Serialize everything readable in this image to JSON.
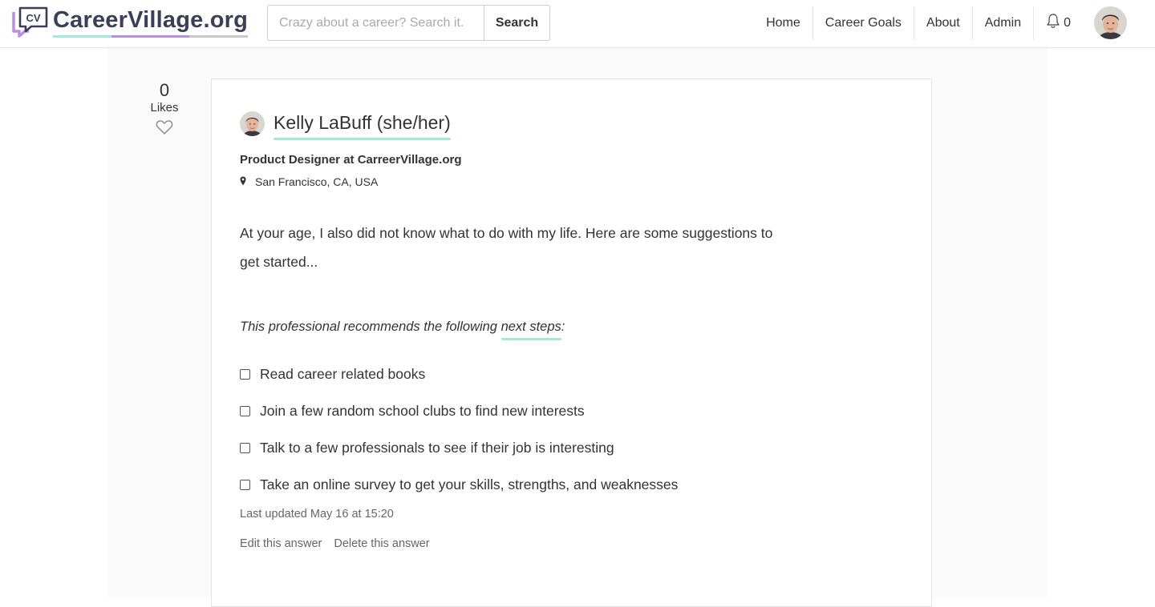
{
  "brand": {
    "logo_mark_text": "CV",
    "name": "CareerVillage.org",
    "colors": {
      "teal": "#a8e6d7",
      "purple": "#b98fe0",
      "gray": "#c8c8c8",
      "text": "#3b3f55"
    }
  },
  "search": {
    "placeholder": "Crazy about a career? Search it.",
    "value": "",
    "button_label": "Search"
  },
  "nav": {
    "items": [
      {
        "label": "Home"
      },
      {
        "label": "Career Goals"
      },
      {
        "label": "About"
      },
      {
        "label": "Admin"
      }
    ],
    "notifications": {
      "icon": "bell-icon",
      "count": "0"
    },
    "avatar": "user-avatar"
  },
  "likes": {
    "count": "0",
    "label": "Likes",
    "icon": "heart-icon"
  },
  "answer": {
    "author": {
      "name": "Kelly LaBuff (she/her)",
      "role": "Product Designer at CarreerVillage.org",
      "location": "San Francisco, CA, USA",
      "location_icon": "map-pin-icon"
    },
    "body_line1": "At your age, I also did not know what to do with my life. Here are some suggestions to",
    "body_line2": "get started...",
    "recommendation_prefix": "This professional recommends the following ",
    "recommendation_link": "next steps:",
    "steps": [
      {
        "label": "Read career related books",
        "checked": false
      },
      {
        "label": "Join a few random school clubs to find new interests",
        "checked": false
      },
      {
        "label": "Talk to a few professionals to see if their job is interesting",
        "checked": false
      },
      {
        "label": "Take an online survey to get your skills, strengths, and weaknesses",
        "checked": false
      }
    ],
    "last_updated": "Last updated May 16 at 15:20",
    "edit_label": "Edit this answer",
    "delete_label": "Delete this answer"
  }
}
